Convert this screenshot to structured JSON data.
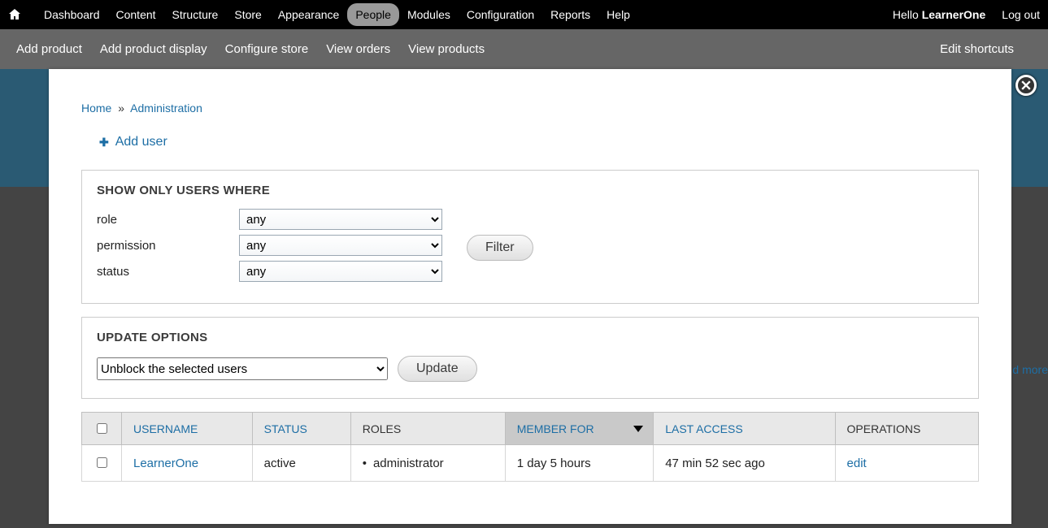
{
  "toolbar": {
    "items": [
      "Dashboard",
      "Content",
      "Structure",
      "Store",
      "Appearance",
      "People",
      "Modules",
      "Configuration",
      "Reports",
      "Help"
    ],
    "active_index": 5,
    "hello_prefix": "Hello ",
    "username": "LearnerOne",
    "logout": "Log out"
  },
  "shortcuts": {
    "items": [
      "Add product",
      "Add product display",
      "Configure store",
      "View orders",
      "View products"
    ],
    "edit_label": "Edit shortcuts"
  },
  "breadcrumb": {
    "home": "Home",
    "sep": "»",
    "admin": "Administration"
  },
  "add_user": {
    "label": "Add user"
  },
  "filters": {
    "title": "SHOW ONLY USERS WHERE",
    "role_label": "role",
    "role_value": "any",
    "permission_label": "permission",
    "permission_value": "any",
    "status_label": "status",
    "status_value": "any",
    "button": "Filter"
  },
  "update": {
    "title": "UPDATE OPTIONS",
    "selected": "Unblock the selected users",
    "button": "Update"
  },
  "table": {
    "headers": {
      "username": "USERNAME",
      "status": "STATUS",
      "roles": "ROLES",
      "member_for": "MEMBER FOR",
      "last_access": "LAST ACCESS",
      "operations": "OPERATIONS"
    },
    "rows": [
      {
        "username": "LearnerOne",
        "status": "active",
        "role": "administrator",
        "member_for": "1 day 5 hours",
        "last_access": "47 min 52 sec ago",
        "op": "edit"
      }
    ]
  },
  "bg": {
    "more": "d more"
  }
}
